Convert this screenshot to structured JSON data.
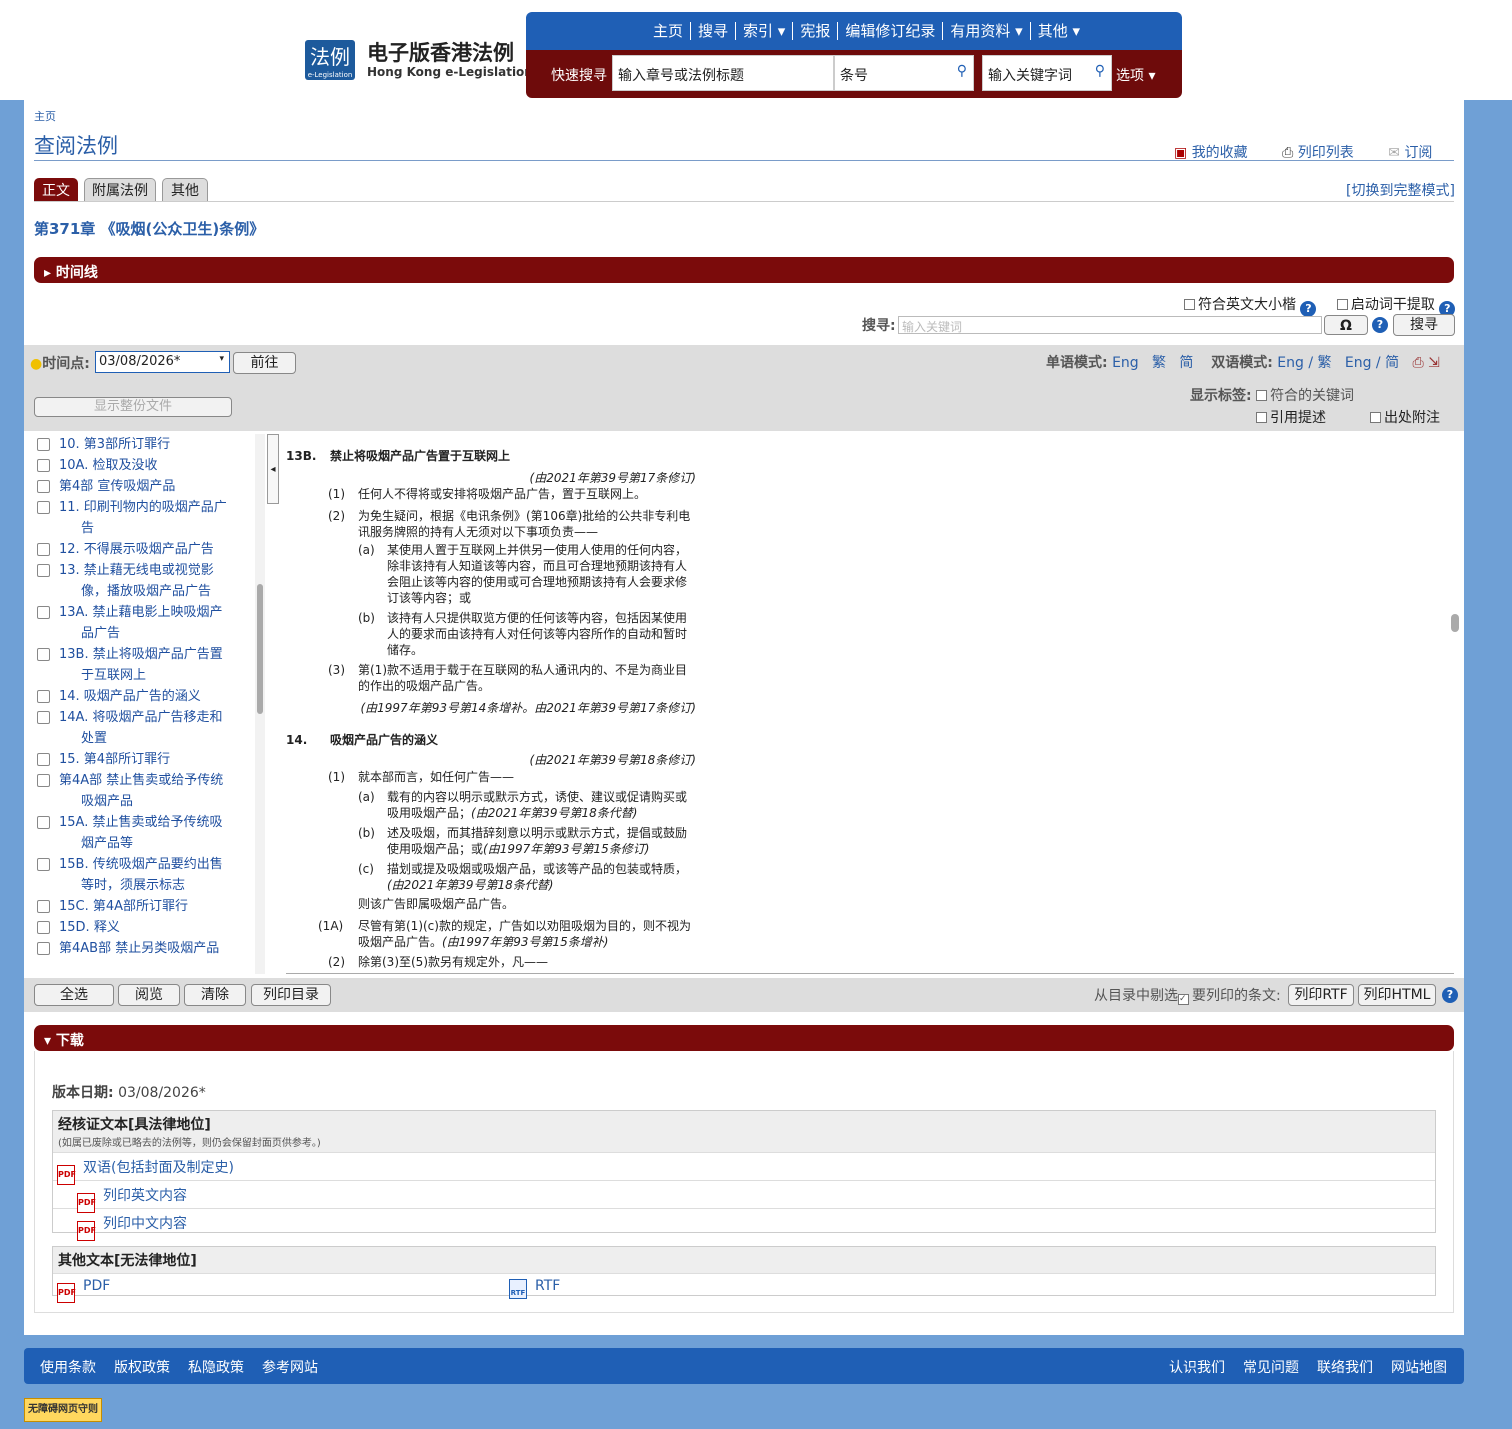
{
  "logo": {
    "mark": "法例",
    "mark_sub": "e-Legislation",
    "title_cn": "电子版香港法例",
    "title_en": "Hong Kong e-Legislation"
  },
  "nav": {
    "items": [
      "主页",
      "搜寻",
      "索引 ▾",
      "宪报",
      "编辑修订纪录",
      "有用资料 ▾",
      "其他 ▾"
    ],
    "quick_label": "快速搜寻",
    "chapter_placeholder": "输入章号或法例标题",
    "section_placeholder": "条号",
    "keyword_placeholder": "输入关键字词",
    "options_label": "选项 ▾"
  },
  "breadcrumb": "主页",
  "page_title": "查阅法例",
  "tools": {
    "favorites": "我的收藏",
    "print_list": "列印列表",
    "subscribe": "订阅"
  },
  "tabs": [
    "正文",
    "附属法例",
    "其他"
  ],
  "switch_mode": "[切换到完整模式]",
  "chapter_title": "第371章 《吸烟(公众卫生)条例》",
  "timeline_bar": "时间线",
  "search_opts": {
    "case": "符合英文大小楷",
    "stem": "启动词干提取",
    "search_label": "搜寻:",
    "search_placeholder": "输入关键词",
    "omega": "Ω",
    "search_btn": "搜寻"
  },
  "timepoint": {
    "label": "时间点:",
    "value": "03/08/2026*",
    "go": "前往"
  },
  "lang": {
    "single_label": "单语模式:",
    "eng": "Eng",
    "trad": "繁",
    "simp": "简",
    "bi_label": "双语模式:",
    "bi1": "Eng / 繁",
    "bi2": "Eng / 简"
  },
  "show_tags": {
    "label": "显示标签:",
    "kw": "符合的关键词",
    "cite": "引用提述",
    "src": "出处附注"
  },
  "show_whole": "显示整份文件",
  "toc": [
    {
      "l": "10. 第3部所订罪行"
    },
    {
      "l": "10A. 检取及没收"
    },
    {
      "l": "第4部 宣传吸烟产品"
    },
    {
      "l": "11. 印刷刊物内的吸烟产品广",
      "c": "告"
    },
    {
      "l": "12. 不得展示吸烟产品广告"
    },
    {
      "l": "13. 禁止藉无线电或视觉影",
      "c": "像，播放吸烟产品广告"
    },
    {
      "l": "13A. 禁止藉电影上映吸烟产",
      "c": "品广告"
    },
    {
      "l": "13B. 禁止将吸烟产品广告置",
      "c": "于互联网上"
    },
    {
      "l": "14. 吸烟产品广告的涵义"
    },
    {
      "l": "14A. 将吸烟产品广告移走和",
      "c": "处置"
    },
    {
      "l": "15. 第4部所订罪行"
    },
    {
      "l": "第4A部 禁止售卖或给予传统",
      "c": "吸烟产品"
    },
    {
      "l": "15A. 禁止售卖或给予传统吸",
      "c": "烟产品等"
    },
    {
      "l": "15B. 传统吸烟产品要约出售",
      "c": "等时，须展示标志"
    },
    {
      "l": "15C. 第4A部所订罪行"
    },
    {
      "l": "15D. 释义"
    },
    {
      "l": "第4AB部 禁止另类吸烟产品"
    }
  ],
  "text": {
    "s13b_num": "13B.",
    "s13b_title": "禁止将吸烟产品广告置于互联网上",
    "s13b_amend": "(由2021年第39号第17条修订)",
    "s13b_1n": "(1)",
    "s13b_1": "任何人不得将或安排将吸烟产品广告，置于互联网上。",
    "s13b_2n": "(2)",
    "s13b_2": "为免生疑问，根据《电讯条例》(第106章)批给的公共非专利电讯服务牌照的持有人无须对以下事项负责——",
    "s13b_2an": "(a)",
    "s13b_2a": "某使用人置于互联网上并供另一使用人使用的任何内容，除非该持有人知道该等内容，而且可合理地预期该持有人会阻止该等内容的使用或可合理地预期该持有人会要求修订该等内容；或",
    "s13b_2bn": "(b)",
    "s13b_2b": "该持有人只提供取览方便的任何该等内容，包括因某使用人的要求而由该持有人对任何该等内容所作的自动和暂时储存。",
    "s13b_3n": "(3)",
    "s13b_3": "第(1)款不适用于载于在互联网的私人通讯内的、不是为商业目的作出的吸烟产品广告。",
    "s13b_hist": "(由1997年第93号第14条增补。由2021年第39号第17条修订)",
    "s14_num": "14.",
    "s14_title": "吸烟产品广告的涵义",
    "s14_amend": "(由2021年第39号第18条修订)",
    "s14_1n": "(1)",
    "s14_1": "就本部而言，如任何广告——",
    "s14_1an": "(a)",
    "s14_1a": "载有的内容以明示或默示方式，诱使、建议或促请购买或吸用吸烟产品；",
    "s14_1a_h": "(由2021年第39号第18条代替)",
    "s14_1bn": "(b)",
    "s14_1b": "述及吸烟，而其措辞刻意以明示或默示方式，提倡或鼓励使用吸烟产品；或",
    "s14_1b_h": "(由1997年第93号第15条修订)",
    "s14_1cn": "(c)",
    "s14_1c": "描划或提及吸烟或吸烟产品，或该等产品的包装或特质，",
    "s14_1c_h": "(由2021年第39号第18条代替)",
    "s14_1tail": "则该广告即属吸烟产品广告。",
    "s14_1An": "(1A)",
    "s14_1A": "尽管有第(1)(c)款的规定，广告如以劝阻吸烟为目的，则不视为吸烟产品广告。",
    "s14_1A_h": "(由1997年第93号第15条增补)",
    "s14_2n": "(2)",
    "s14_2": "除第(3)至(5)款另有规定外，凡——"
  },
  "toc_buttons": [
    "全选",
    "阅览",
    "清除",
    "列印目录"
  ],
  "print_opts": {
    "label": "从目录中剔选",
    "label2": "要列印的条文:",
    "rtf": "列印RTF",
    "html": "列印HTML"
  },
  "download_bar": "下载",
  "download": {
    "version_label": "版本日期:",
    "version": "03/08/2026*",
    "verified_title": "经核证文本[具法律地位]",
    "verified_note": "(如属已废除或已略去的法例等，则仍会保留封面页供参考。)",
    "bilingual": "双语(包括封面及制定史)",
    "print_en": "列印英文内容",
    "print_cn": "列印中文内容",
    "other_title": "其他文本[无法律地位]",
    "pdf": "PDF",
    "rtf": "RTF",
    "pdf_icon": "PDF",
    "rtf_icon": "RTF"
  },
  "footer": {
    "left": [
      "使用条款",
      "版权政策",
      "私隐政策",
      "参考网站"
    ],
    "right": [
      "认识我们",
      "常见问题",
      "联络我们",
      "网站地图"
    ]
  },
  "wcag": "无障碍网页守则",
  "colors": {
    "nav_blue": "#1f5fb5",
    "maroon": "#7b0b0b",
    "link": "#2b5fa8"
  }
}
